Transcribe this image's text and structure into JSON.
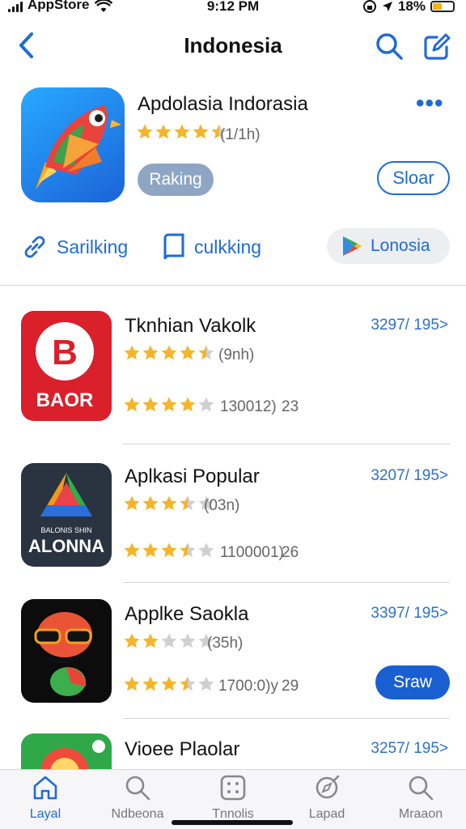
{
  "status_bar": {
    "carrier": "AppStore",
    "time": "9:12 PM",
    "battery": "18%"
  },
  "nav": {
    "title": "Indonesia",
    "back_icon": "chevron-left-icon",
    "search_icon": "search-icon",
    "edit_icon": "compose-icon"
  },
  "featured": {
    "name": "Apdolasia Indorasia",
    "rating": 4.5,
    "rating_count": "(1/1h)",
    "tag_label": "Raking",
    "action_label": "Sloar",
    "more_label": "•••"
  },
  "links": [
    {
      "label": "Sarilking",
      "icon": "link-icon"
    },
    {
      "label": "culkking",
      "icon": "book-icon"
    },
    {
      "label": "Lonosia",
      "icon": "play-store-icon"
    }
  ],
  "apps": [
    {
      "name": "Tknhian Vakolk",
      "meta": "3297/ 195>",
      "rating": 4.5,
      "rating_count": "(9nh)",
      "rating2": 4.0,
      "sub": "130012)",
      "sub_extra": "23",
      "icon_text": "BAOR",
      "icon_letter": "B"
    },
    {
      "name": "Aplkasi Popular",
      "meta": "3207/ 195>",
      "rating": 3.5,
      "rating_count": "(03n)",
      "rating2": 3.5,
      "sub": "1100001)",
      "sub_extra": "26",
      "icon_text": "ALONNA",
      "icon_small": "BALONIS SHIN"
    },
    {
      "name": "Applke Saokla",
      "meta": "3397/ 195>",
      "rating": 2.0,
      "rating_count": "(35h)",
      "rating2": 3.5,
      "sub": "1700:0)y",
      "sub_extra": "29",
      "button": "Sraw"
    },
    {
      "name": "Vioee Plaolar",
      "meta": "3257/ 195>"
    }
  ],
  "tabbar": [
    {
      "label": "Layal",
      "icon": "home-icon",
      "active": true
    },
    {
      "label": "Ndbeona",
      "icon": "search-icon"
    },
    {
      "label": "Tnnolis",
      "icon": "grid-icon"
    },
    {
      "label": "Lapad",
      "icon": "compass-icon"
    },
    {
      "label": "Mraaon",
      "icon": "search-icon"
    }
  ],
  "colors": {
    "accent": "#1f6bd6",
    "star": "#f5b52a",
    "star_empty": "#d0d0d0",
    "button": "#1a5fd2"
  }
}
